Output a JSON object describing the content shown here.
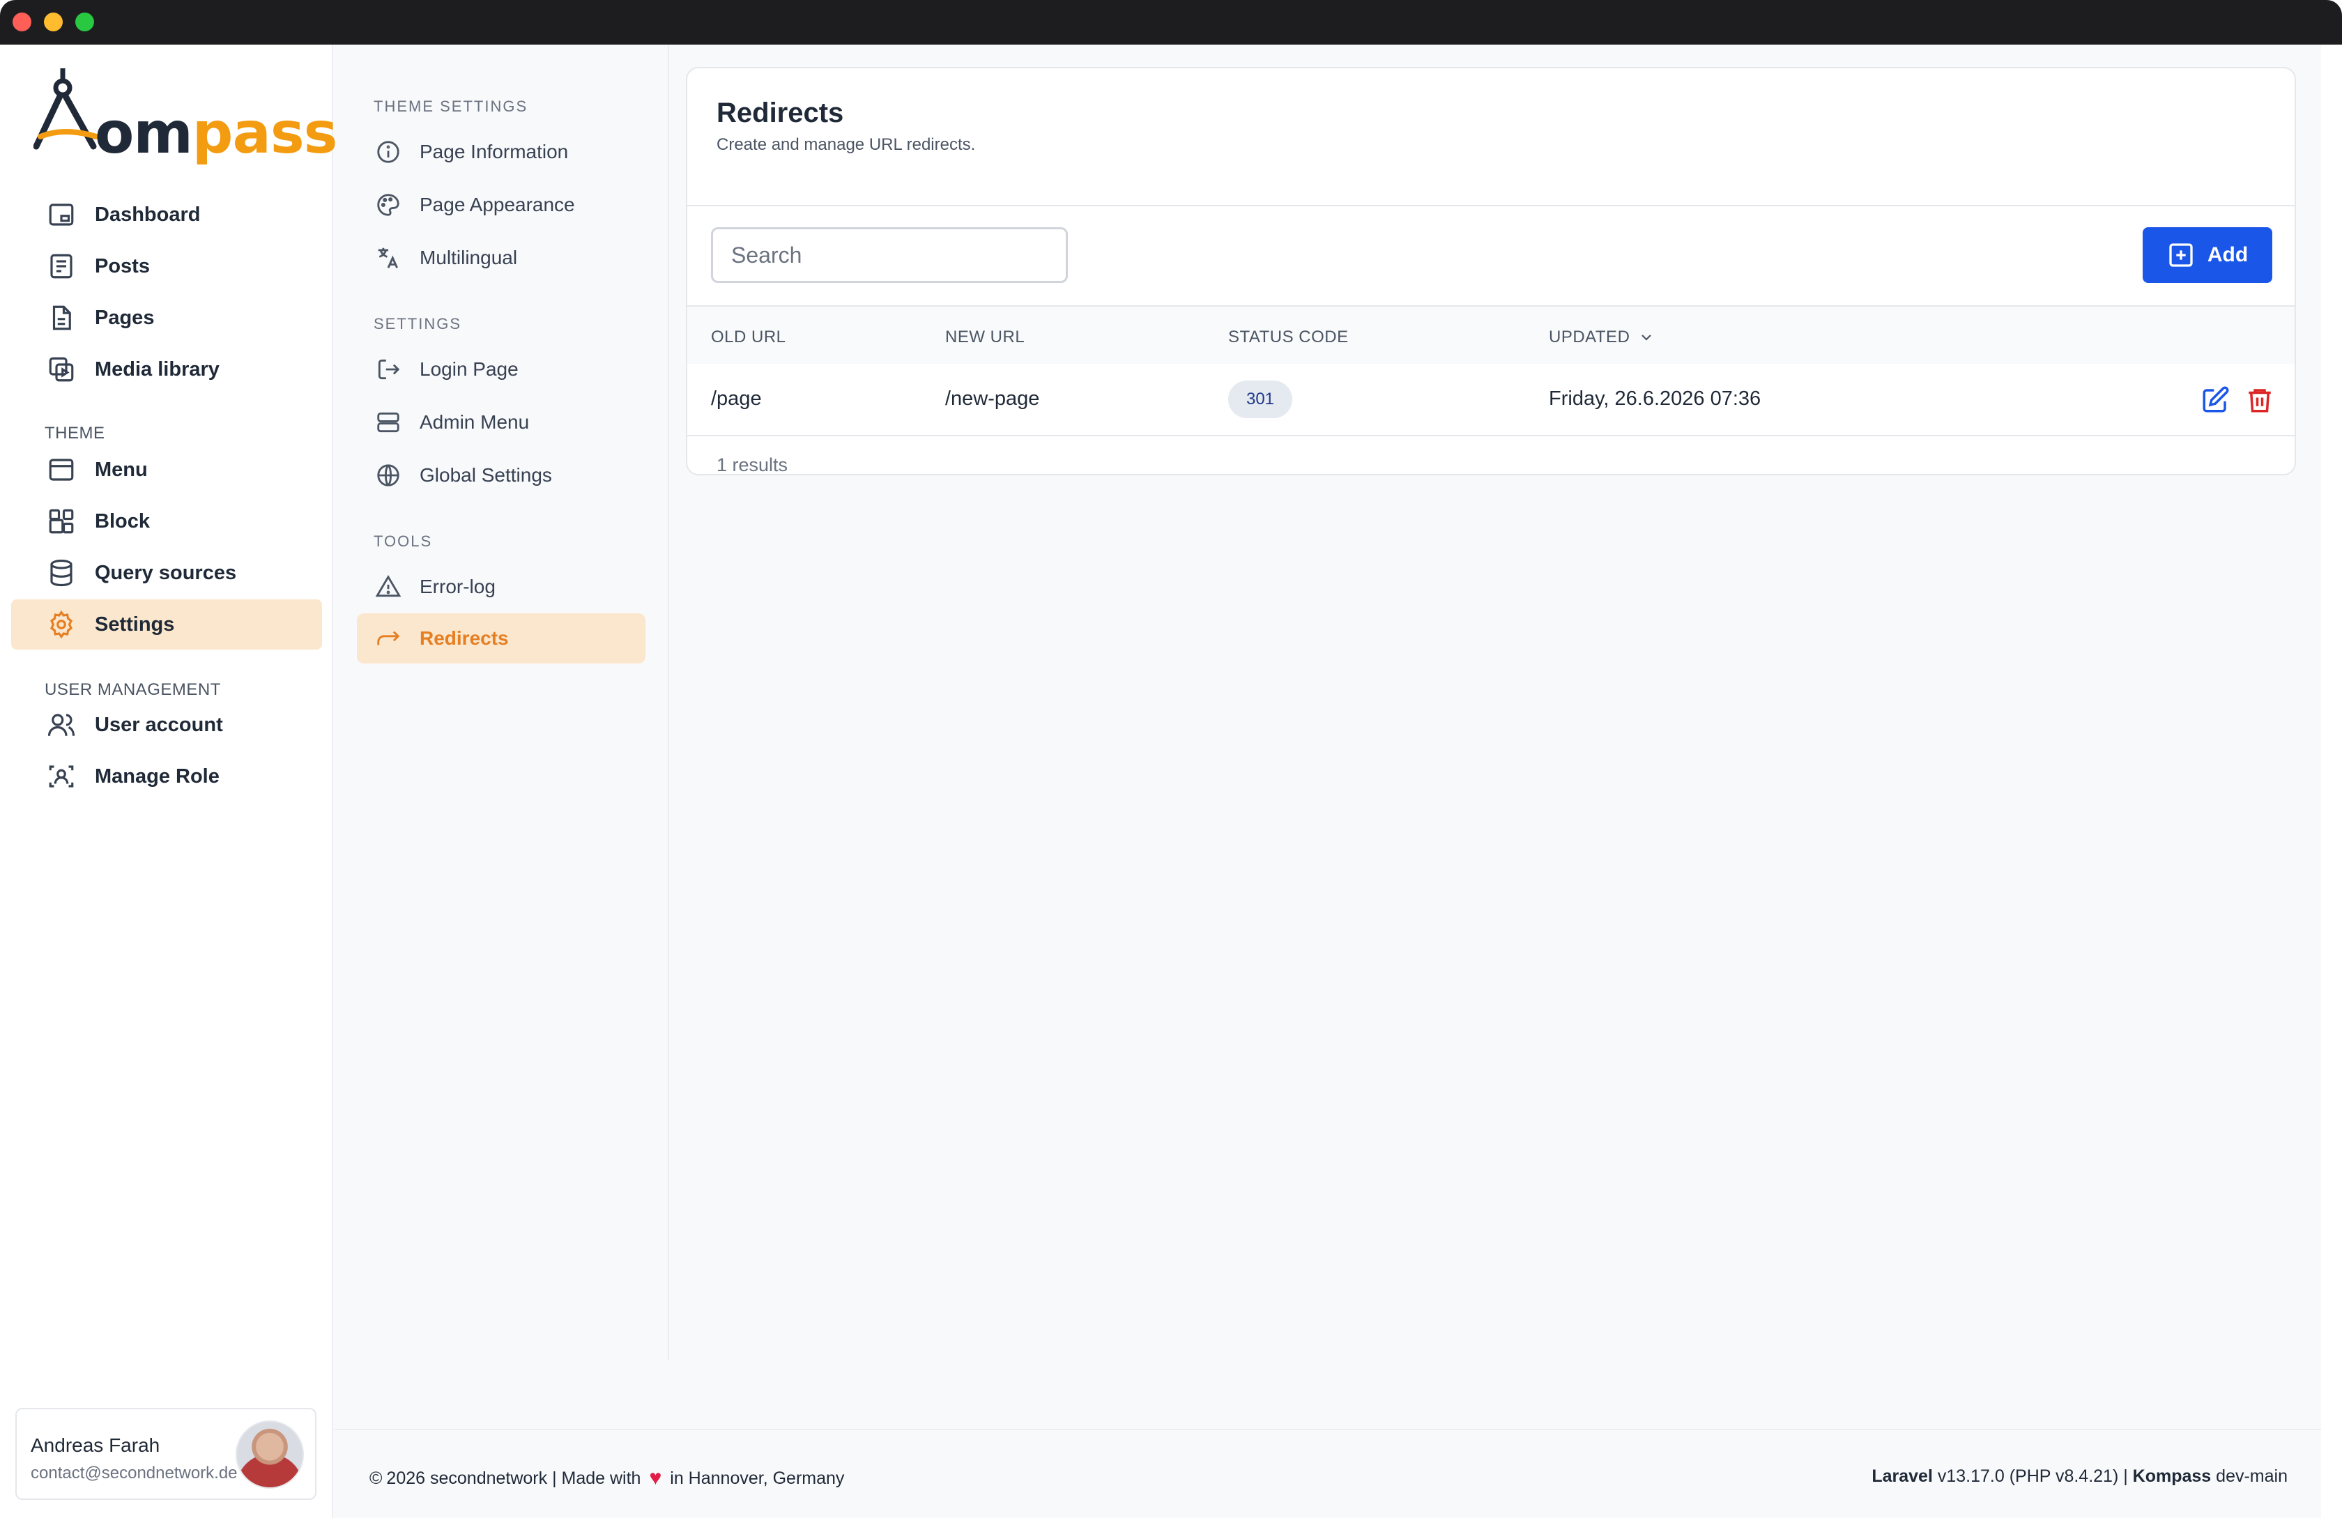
{
  "brand": {
    "name": "Kompass",
    "logo_part1": "om",
    "logo_part2": "pass",
    "accent": "#f39c12"
  },
  "sidebar": {
    "items": [
      {
        "label": "Dashboard",
        "icon": "dashboard-icon"
      },
      {
        "label": "Posts",
        "icon": "posts-icon"
      },
      {
        "label": "Pages",
        "icon": "pages-icon"
      },
      {
        "label": "Media library",
        "icon": "media-icon"
      }
    ],
    "theme_label": "THEME",
    "theme_items": [
      {
        "label": "Menu",
        "icon": "menu-icon"
      },
      {
        "label": "Block",
        "icon": "block-icon"
      },
      {
        "label": "Query sources",
        "icon": "database-icon"
      },
      {
        "label": "Settings",
        "icon": "gear-icon",
        "active": true
      }
    ],
    "user_mgmt_label": "USER MANAGEMENT",
    "user_items": [
      {
        "label": "User account",
        "icon": "users-icon"
      },
      {
        "label": "Manage Role",
        "icon": "role-icon"
      }
    ],
    "user": {
      "name": "Andreas Farah",
      "email": "contact@secondnetwork.de"
    }
  },
  "subnav": {
    "theme_settings_label": "THEME SETTINGS",
    "theme_settings": [
      {
        "label": "Page Information"
      },
      {
        "label": "Page Appearance"
      },
      {
        "label": "Multilingual"
      }
    ],
    "settings_label": "SETTINGS",
    "settings": [
      {
        "label": "Login Page"
      },
      {
        "label": "Admin Menu"
      },
      {
        "label": "Global Settings"
      }
    ],
    "tools_label": "TOOLS",
    "tools": [
      {
        "label": "Error-log"
      },
      {
        "label": "Redirects",
        "active": true
      }
    ]
  },
  "main": {
    "title": "Redirects",
    "subtitle": "Create and manage URL redirects.",
    "search_placeholder": "Search",
    "add_label": "Add",
    "columns": [
      "OLD URL",
      "NEW URL",
      "STATUS CODE",
      "UPDATED"
    ],
    "rows": [
      {
        "old_url": "/page",
        "new_url": "/new-page",
        "status": "301",
        "updated": "Friday, 26.6.2026 07:36"
      }
    ],
    "results": "1 results"
  },
  "footer": {
    "copyright": "2026 secondnetwork | Made with",
    "location": "in Hannover, Germany",
    "laravel": "Laravel",
    "laravel_version": "v13.17.0 (PHP v8.4.21) |",
    "kompass": "Kompass",
    "kompass_version": "dev-main"
  },
  "colors": {
    "primary": "#1a56e8",
    "active_bg": "#fbe7cd",
    "danger": "#dc2626"
  }
}
